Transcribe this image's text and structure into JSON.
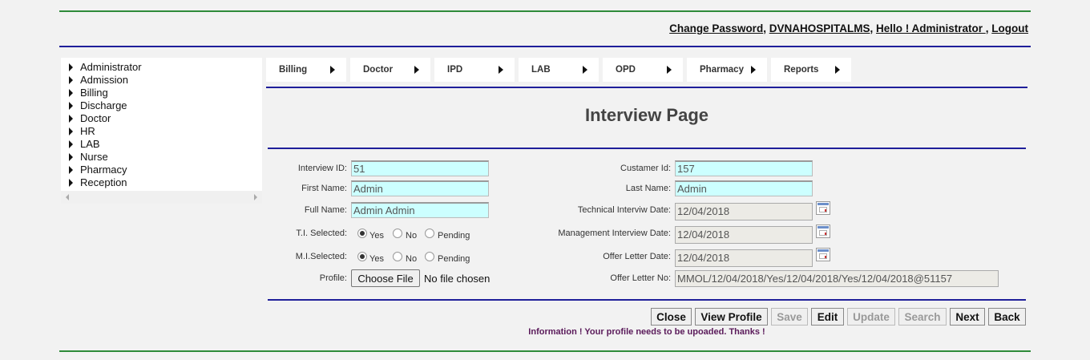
{
  "header": {
    "links": [
      {
        "label": "Change Password"
      },
      {
        "label": "DVNAHOSPITALMS"
      },
      {
        "label": "Hello ! Administrator "
      },
      {
        "label": " Logout"
      }
    ],
    "sep": ", "
  },
  "sidebar": {
    "items": [
      {
        "label": "Administrator"
      },
      {
        "label": "Admission"
      },
      {
        "label": "Billing"
      },
      {
        "label": "Discharge"
      },
      {
        "label": "Doctor"
      },
      {
        "label": "HR"
      },
      {
        "label": "LAB"
      },
      {
        "label": "Nurse"
      },
      {
        "label": "Pharmacy"
      },
      {
        "label": "Reception"
      }
    ]
  },
  "menu": {
    "items": [
      {
        "label": "Billing"
      },
      {
        "label": "Doctor"
      },
      {
        "label": "IPD"
      },
      {
        "label": "LAB"
      },
      {
        "label": "OPD"
      },
      {
        "label": "Pharmacy"
      },
      {
        "label": "Reports"
      }
    ]
  },
  "page": {
    "title": "Interview Page"
  },
  "form": {
    "interview_id": {
      "label": "Interview ID:",
      "value": "51"
    },
    "first_name": {
      "label": "First Name:",
      "value": "Admin"
    },
    "full_name": {
      "label": "Full Name:",
      "value": "Admin Admin"
    },
    "ti_selected": {
      "label": "T.I. Selected:",
      "options": [
        "Yes",
        "No",
        "Pending"
      ],
      "selected": "Yes"
    },
    "mi_selected": {
      "label": "M.I.Selected:",
      "options": [
        "Yes",
        "No",
        "Pending"
      ],
      "selected": "Yes"
    },
    "profile": {
      "label": "Profile:",
      "button": "Choose File",
      "status": "No file chosen"
    },
    "customer_id": {
      "label": "Custamer Id:",
      "value": "157"
    },
    "last_name": {
      "label": "Last Name:",
      "value": "Admin"
    },
    "technical_date": {
      "label": "Technical Interviw Date:",
      "value": "12/04/2018"
    },
    "management_date": {
      "label": "Management Interview Date:",
      "value": "12/04/2018"
    },
    "offer_date": {
      "label": "Offer Letter Date:",
      "value": "12/04/2018"
    },
    "offer_no": {
      "label": "Offer Letter No:",
      "value": "MMOL/12/04/2018/Yes/12/04/2018/Yes/12/04/2018@51157"
    }
  },
  "actions": {
    "close": "Close",
    "view_profile": "View Profile",
    "save": "Save",
    "edit": "Edit",
    "update": "Update",
    "search": "Search",
    "next": "Next",
    "back": "Back"
  },
  "info": "Information ! Your profile needs to be upoaded. Thanks !",
  "colors": {
    "background": "#f2f2f2",
    "green_rule": "#2e8b3a",
    "navy_rule": "#1f1f9a",
    "input_cyan": "#ccffff",
    "info_text": "#5a1a5a"
  }
}
